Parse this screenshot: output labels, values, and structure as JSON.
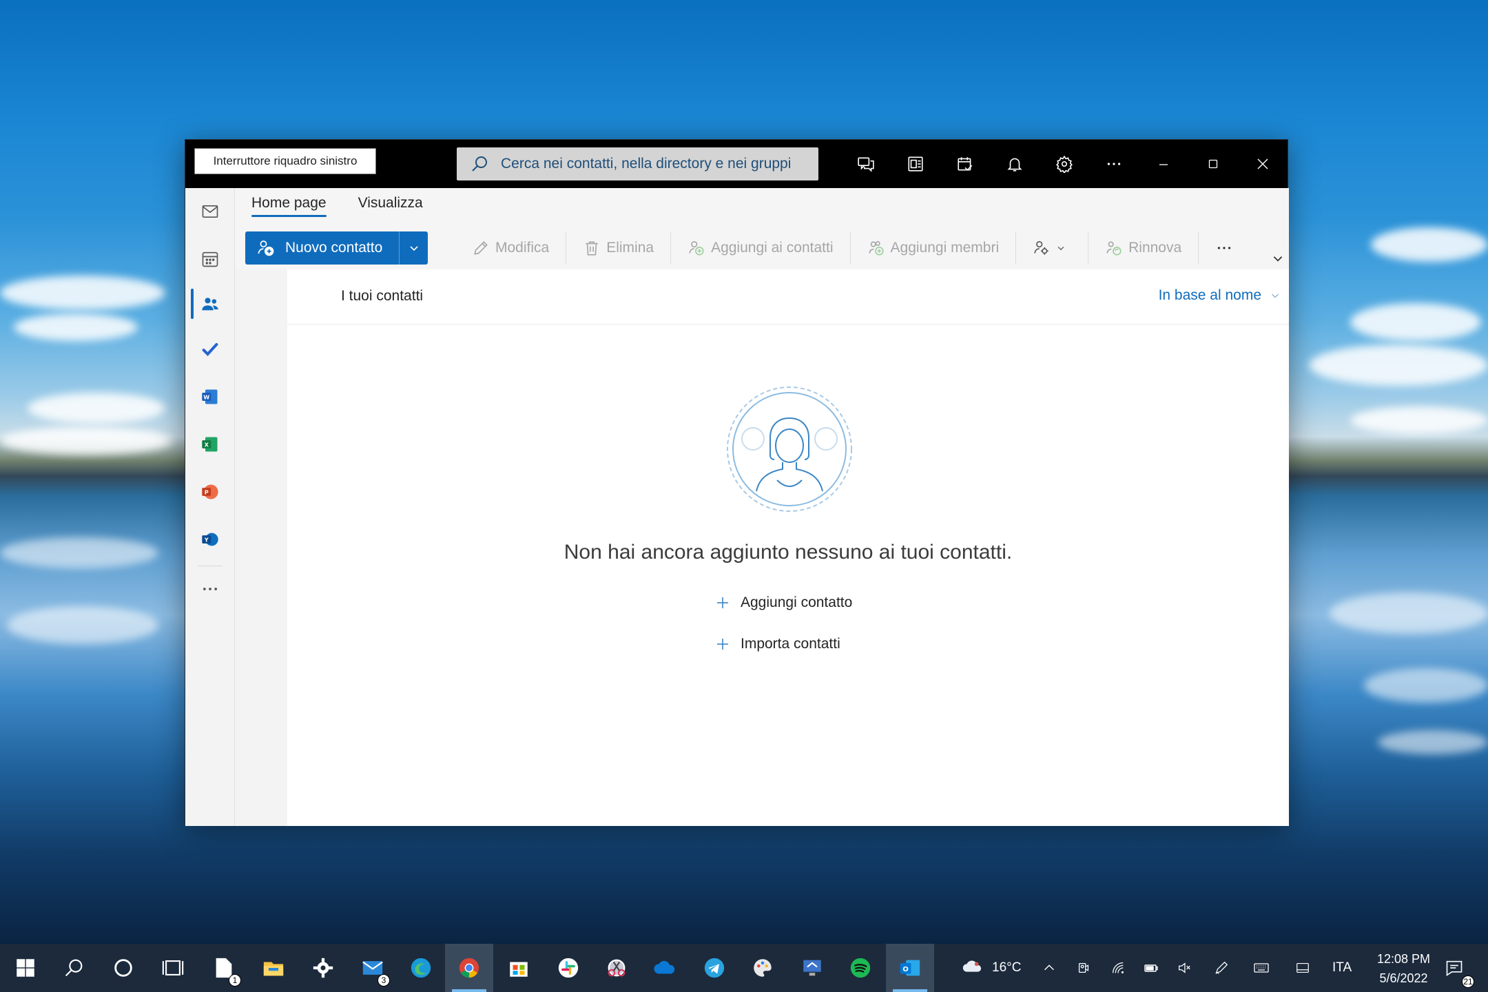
{
  "window": {
    "pane_toggle_label": "Interruttore riquadro sinistro",
    "search_placeholder": "Cerca nei contatti, nella directory e nei gruppi"
  },
  "ribbon": {
    "tabs": [
      {
        "label": "Home page",
        "active": true
      },
      {
        "label": "Visualizza",
        "active": false
      }
    ],
    "new_contact_label": "Nuovo contatto",
    "commands": {
      "edit": "Modifica",
      "delete": "Elimina",
      "add_to_contacts": "Aggiungi ai contatti",
      "add_members": "Aggiungi membri",
      "renew": "Rinnova",
      "more": "···"
    }
  },
  "list": {
    "title": "I tuoi contatti",
    "sort_label": "In base al nome"
  },
  "empty_state": {
    "message": "Non hai ancora aggiunto nessuno ai tuoi contatti.",
    "add_contact": "Aggiungi contatto",
    "import_contacts": "Importa contatti"
  },
  "taskbar": {
    "temperature": "16°C",
    "language": "ITA",
    "time": "12:08 PM",
    "date": "5/6/2022",
    "notification_count": "21",
    "mail_badge": "3",
    "explorer_badge": "1"
  },
  "colors": {
    "accent": "#0f6cbd",
    "titlebar": "#000000",
    "taskbar": "#1c2a3c"
  }
}
